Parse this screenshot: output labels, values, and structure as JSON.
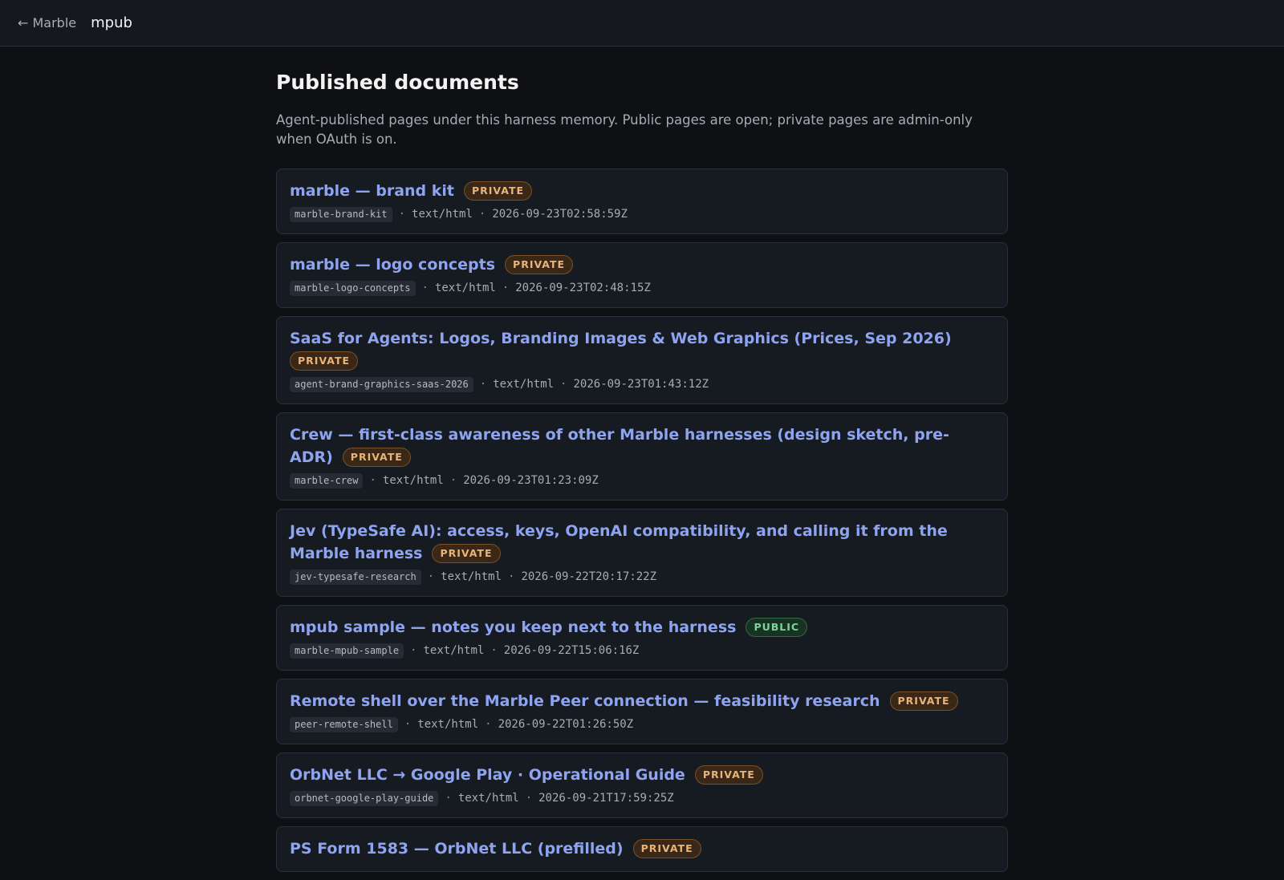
{
  "header": {
    "back_label": "← Marble",
    "app_name": "mpub"
  },
  "main": {
    "title": "Published documents",
    "intro": "Agent-published pages under this harness memory. Public pages are open; private pages are admin-only when OAuth is on."
  },
  "documents": [
    {
      "title": "marble — brand kit",
      "visibility": "PRIVATE",
      "slug": "marble-brand-kit",
      "mime": "text/html",
      "timestamp": "2026-09-23T02:58:59Z"
    },
    {
      "title": "marble — logo concepts",
      "visibility": "PRIVATE",
      "slug": "marble-logo-concepts",
      "mime": "text/html",
      "timestamp": "2026-09-23T02:48:15Z"
    },
    {
      "title": "SaaS for Agents: Logos, Branding Images & Web Graphics (Prices, Sep 2026)",
      "visibility": "PRIVATE",
      "slug": "agent-brand-graphics-saas-2026",
      "mime": "text/html",
      "timestamp": "2026-09-23T01:43:12Z"
    },
    {
      "title": "Crew — first-class awareness of other Marble harnesses (design sketch, pre-ADR)",
      "visibility": "PRIVATE",
      "slug": "marble-crew",
      "mime": "text/html",
      "timestamp": "2026-09-23T01:23:09Z"
    },
    {
      "title": "Jev (TypeSafe AI): access, keys, OpenAI compatibility, and calling it from the Marble harness",
      "visibility": "PRIVATE",
      "slug": "jev-typesafe-research",
      "mime": "text/html",
      "timestamp": "2026-09-22T20:17:22Z"
    },
    {
      "title": "mpub sample — notes you keep next to the harness",
      "visibility": "PUBLIC",
      "slug": "marble-mpub-sample",
      "mime": "text/html",
      "timestamp": "2026-09-22T15:06:16Z"
    },
    {
      "title": "Remote shell over the Marble Peer connection — feasibility research",
      "visibility": "PRIVATE",
      "slug": "peer-remote-shell",
      "mime": "text/html",
      "timestamp": "2026-09-22T01:26:50Z"
    },
    {
      "title": "OrbNet LLC → Google Play · Operational Guide",
      "visibility": "PRIVATE",
      "slug": "orbnet-google-play-guide",
      "mime": "text/html",
      "timestamp": "2026-09-21T17:59:25Z"
    },
    {
      "title": "PS Form 1583 — OrbNet LLC (prefilled)",
      "visibility": "PRIVATE",
      "slug": "",
      "mime": "",
      "timestamp": ""
    }
  ],
  "separator": "·"
}
